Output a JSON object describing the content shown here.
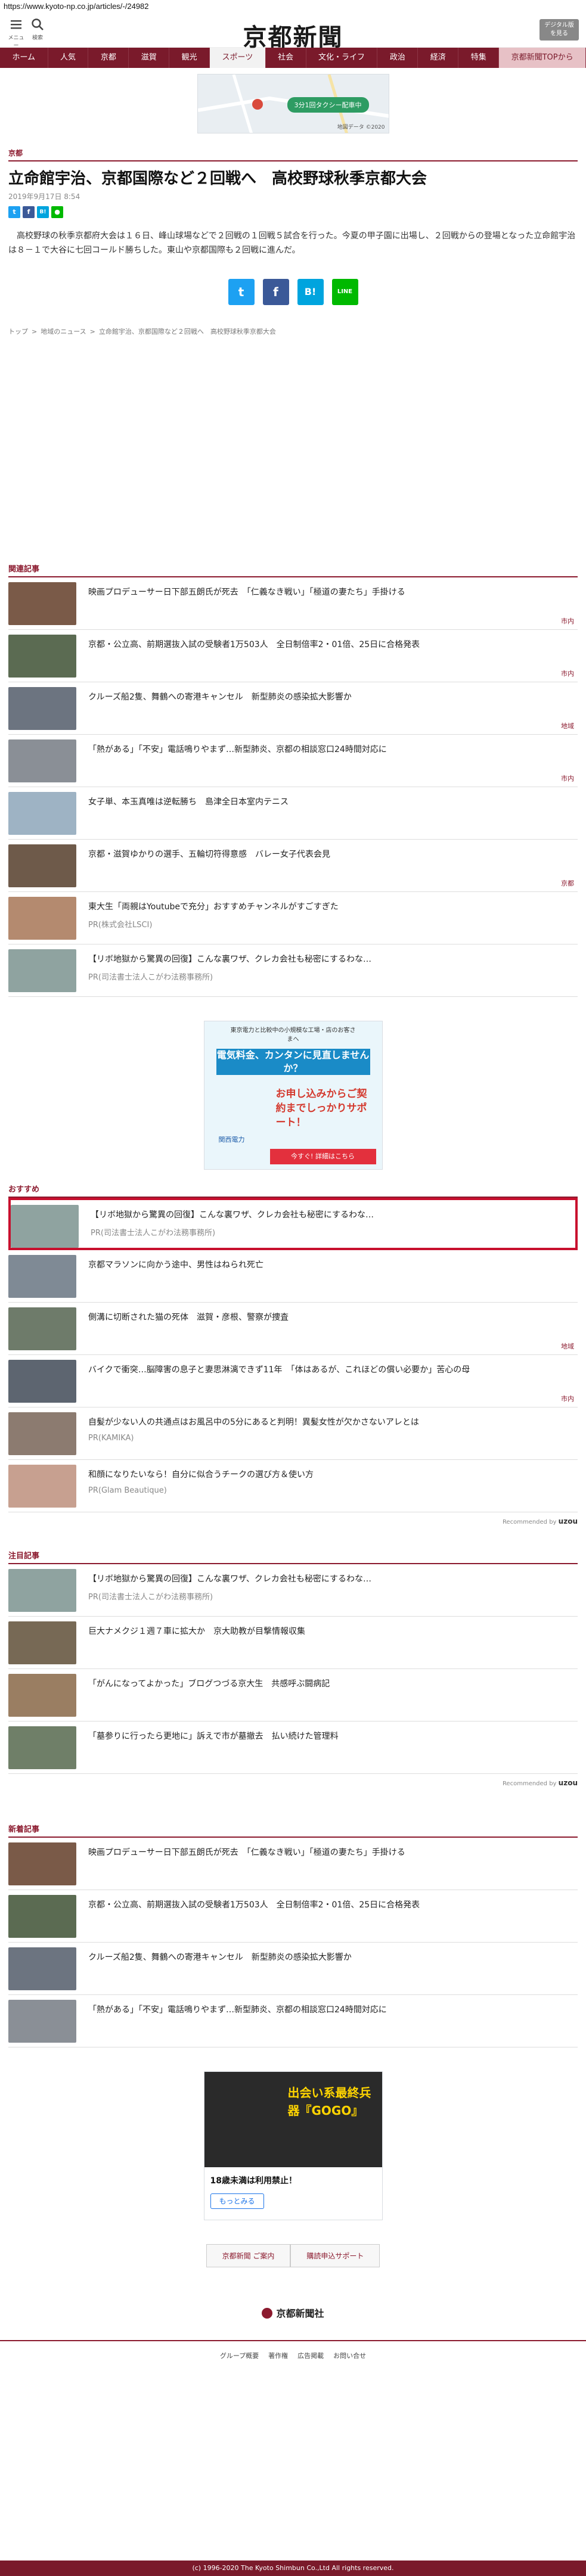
{
  "url": "https://www.kyoto-np.co.jp/articles/-/24982",
  "header": {
    "menu_label": "メニュー",
    "search_label": "検索",
    "logo": "京都新聞",
    "digital_button": "デジタル版\nを見る"
  },
  "nav": [
    "ホーム",
    "人気",
    "京都",
    "滋賀",
    "観光",
    "スポーツ",
    "社会",
    "文化・ライフ",
    "政治",
    "経済",
    "特集",
    "京都新聞TOPから"
  ],
  "nav_active_index": 5,
  "top_ad": {
    "banner_text": "3分1回タクシー配車中",
    "caption": "地図データ ©2020"
  },
  "article": {
    "category": "京都",
    "title": "立命館宇治、京都国際など２回戦へ　高校野球秋季京都大会",
    "date": "2019年9月17日 8:54",
    "body": "高校野球の秋季京都府大会は１６日、峰山球場などで２回戦の１回戦５試合を行った。今夏の甲子園に出場し、２回戦からの登場となった立命館宇治は８－１で大谷に七回コールド勝ちした。東山や京都国際も２回戦に進んだ。",
    "share": {
      "hatena": "B!",
      "line": "LINE"
    }
  },
  "breadcrumb": [
    "トップ",
    "地域のニュース",
    "立命館宇治、京都国際など２回戦へ　高校野球秋季京都大会"
  ],
  "related": {
    "heading": "関連記事",
    "items": [
      {
        "title": "映画プロデューサー日下部五朗氏が死去　「仁義なき戦い」「極道の妻たち」手掛ける",
        "tag": "市内",
        "thumb": "#7a5a48"
      },
      {
        "title": "京都・公立高、前期選抜入試の受験者1万503人　全日制倍率2・01倍、25日に合格発表",
        "tag": "市内",
        "thumb": "#5b6b52"
      },
      {
        "title": "クルーズ船2隻、舞鶴への寄港キャンセル　新型肺炎の感染拡大影響か",
        "tag": "地域",
        "thumb": "#6c7480"
      },
      {
        "title": "「熱がある」「不安」電話鳴りやまず…新型肺炎、京都の相談窓口24時間対応に",
        "tag": "市内",
        "thumb": "#8a8f96"
      },
      {
        "title": "女子単、本玉真唯は逆転勝ち　島津全日本室内テニス",
        "tag": "",
        "thumb": "#9eb3c4"
      },
      {
        "title": "京都・滋賀ゆかりの選手、五輪切符得意感　バレー女子代表会見",
        "tag": "京都",
        "thumb": "#6e5a4a"
      },
      {
        "title": "東大生「両親はYoutubeで充分」おすすめチャンネルがすごすぎた",
        "sub": "PR(株式会社LSCI)",
        "tag": "",
        "thumb": "#b48a6f"
      },
      {
        "title": "【リボ地獄から驚異の回復】こんな裏ワザ、クレカ会社も秘密にするわな…",
        "sub": "PR(司法書士法人こがわ法務事務所)",
        "tag": "",
        "thumb": "#8fa3a0"
      }
    ]
  },
  "mid_ad": {
    "top_text": "東京電力と比較中の小規模な工場・店のお客さまへ",
    "headline": "電気料金、カンタンに見直しませんか？",
    "cta": "お申し込みからご契約までしっかりサポート！",
    "button": "今すぐ! 詳細はこちら",
    "brand": "関西電力"
  },
  "recommend": {
    "heading": "おすすめ",
    "items": [
      {
        "title": "【リボ地獄から驚異の回復】こんな裏ワザ、クレカ会社も秘密にするわな…",
        "sub": "PR(司法書士法人こがわ法務事務所)",
        "tag": "",
        "thumb": "#8fa3a0"
      },
      {
        "title": "京都マラソンに向かう途中、男性はねられ死亡",
        "tag": "",
        "thumb": "#7f8a95"
      },
      {
        "title": "側溝に切断された猫の死体　滋賀・彦根、警察が捜査",
        "tag": "地域",
        "thumb": "#6e7b6a"
      },
      {
        "title": "バイクで衝突…脳障害の息子と妻思淋漓できず11年　「体はあるが、これほどの償い必要か」苦心の母",
        "tag": "市内",
        "thumb": "#5d6570"
      },
      {
        "title": "自髪が少ない人の共通点はお風呂中の5分にあると判明！異髪女性が欠かさないアレとは",
        "sub": "PR(KAMIKA)",
        "tag": "",
        "thumb": "#8c7b70"
      },
      {
        "title": "和顔になりたいなら！自分に似合うチークの選び方＆使い方",
        "sub": "PR(Glam Beautique)",
        "tag": "",
        "thumb": "#c7a090"
      }
    ],
    "recommended_by": "Recommended by",
    "brand": "uzou"
  },
  "attention": {
    "heading": "注目記事",
    "items": [
      {
        "title": "【リボ地獄から驚異の回復】こんな裏ワザ、クレカ会社も秘密にするわな…",
        "sub": "PR(司法書士法人こがわ法務事務所)",
        "thumb": "#8fa3a0"
      },
      {
        "title": "巨大ナメクジ１週７車に拡大か　京大助教が目撃情報収集",
        "thumb": "#776955"
      },
      {
        "title": "「がんになってよかった」ブログつづる京大生　共感呼ぶ闘病記",
        "thumb": "#9a7e62"
      },
      {
        "title": "「墓参りに行ったら更地に」訴えで市が墓撤去　払い続けた管理料",
        "thumb": "#6f7f68"
      }
    ],
    "recommended_by": "Recommended by",
    "brand": "uzou"
  },
  "latest": {
    "heading": "新着記事",
    "items": [
      {
        "title": "映画プロデューサー日下部五朗氏が死去　「仁義なき戦い」「極道の妻たち」手掛ける",
        "thumb": "#7a5a48"
      },
      {
        "title": "京都・公立高、前期選抜入試の受験者1万503人　全日制倍率2・01倍、25日に合格発表",
        "thumb": "#5b6b52"
      },
      {
        "title": "クルーズ船2隻、舞鶴への寄港キャンセル　新型肺炎の感染拡大影響か",
        "thumb": "#6c7480"
      },
      {
        "title": "「熱がある」「不安」電話鳴りやまず…新型肺炎、京都の相談窓口24時間対応に",
        "thumb": "#8a8f96"
      }
    ]
  },
  "bottom_ad": {
    "headline": "出会い系最終兵器『GOGO』",
    "sub": "18歳未満は利用禁止！",
    "button": "もっとみる"
  },
  "footer": {
    "links": [
      "京都新聞 ご案内",
      "購読申込サポート"
    ],
    "logo": "京都新聞社",
    "nav": [
      "グループ概要",
      "著作権",
      "広告掲載",
      "お問い合せ"
    ],
    "copyright": "(c) 1996-2020 The Kyoto Shimbun Co.,Ltd All rights reserved."
  }
}
